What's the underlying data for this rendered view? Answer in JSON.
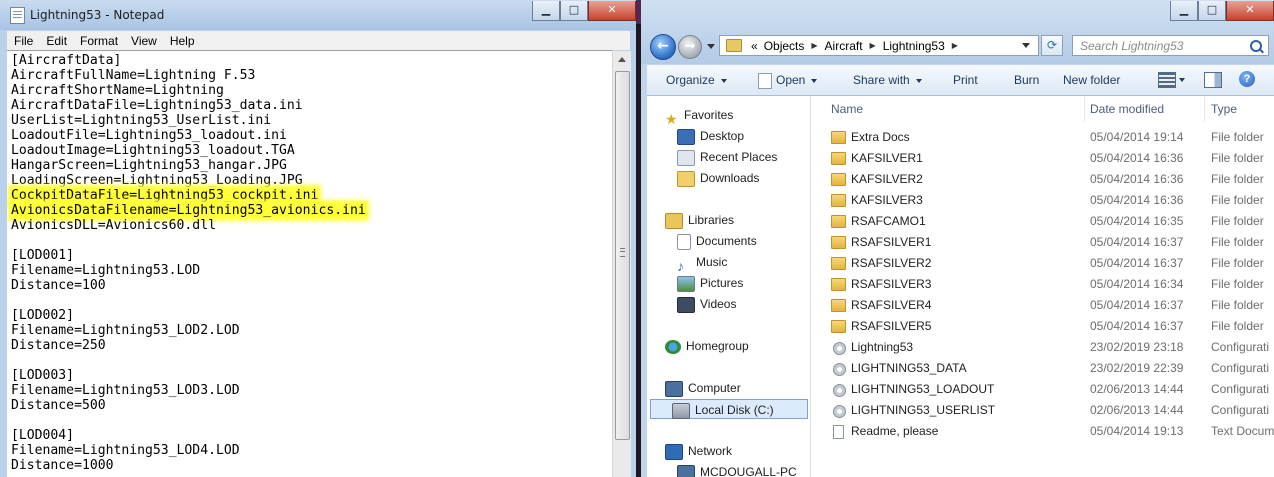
{
  "notepad": {
    "title": "Lightning53 - Notepad",
    "menu": [
      "File",
      "Edit",
      "Format",
      "View",
      "Help"
    ],
    "lines": [
      "[AircraftData]",
      "AircraftFullName=Lightning F.53",
      "AircraftShortName=Lightning",
      "AircraftDataFile=Lightning53_data.ini",
      "UserList=Lightning53_UserList.ini",
      "LoadoutFile=Lightning53_loadout.ini",
      "LoadoutImage=Lightning53_loadout.TGA",
      "HangarScreen=Lightning53_hangar.JPG",
      "LoadingScreen=Lightning53_Loading.JPG",
      "CockpitDataFile=Lightning53_cockpit.ini",
      "AvionicsDataFilename=Lightning53_avionics.ini",
      "AvionicsDLL=Avionics60.dll",
      "",
      "[LOD001]",
      "Filename=Lightning53.LOD",
      "Distance=100",
      "",
      "[LOD002]",
      "Filename=Lightning53_LOD2.LOD",
      "Distance=250",
      "",
      "[LOD003]",
      "Filename=Lightning53_LOD3.LOD",
      "Distance=500",
      "",
      "[LOD004]",
      "Filename=Lightning53_LOD4.LOD",
      "Distance=1000"
    ],
    "highlighted_lines": [
      9,
      10
    ],
    "highlight_color": "#ffff3a"
  },
  "explorer": {
    "address": {
      "overflow": "«",
      "segments": [
        "Objects",
        "Aircraft",
        "Lightning53"
      ]
    },
    "search_placeholder": "Search Lightning53",
    "toolbar": {
      "organize": "Organize",
      "open": "Open",
      "share_with": "Share with",
      "print": "Print",
      "burn": "Burn",
      "new_folder": "New folder"
    },
    "nav": {
      "favorites": "Favorites",
      "desktop": "Desktop",
      "recent_places": "Recent Places",
      "downloads": "Downloads",
      "libraries": "Libraries",
      "documents": "Documents",
      "music": "Music",
      "pictures": "Pictures",
      "videos": "Videos",
      "homegroup": "Homegroup",
      "computer": "Computer",
      "local_disk": "Local Disk (C:)",
      "network": "Network",
      "network_pc": "MCDOUGALL-PC"
    },
    "columns": {
      "name": "Name",
      "date_modified": "Date modified",
      "type": "Type"
    },
    "files": [
      {
        "name": "Extra Docs",
        "date": "05/04/2014 19:14",
        "type": "File folder",
        "icon": "folder-icon"
      },
      {
        "name": "KAFSILVER1",
        "date": "05/04/2014 16:36",
        "type": "File folder",
        "icon": "folder-icon"
      },
      {
        "name": "KAFSILVER2",
        "date": "05/04/2014 16:36",
        "type": "File folder",
        "icon": "folder-icon"
      },
      {
        "name": "KAFSILVER3",
        "date": "05/04/2014 16:36",
        "type": "File folder",
        "icon": "folder-icon"
      },
      {
        "name": "RSAFCAMO1",
        "date": "05/04/2014 16:35",
        "type": "File folder",
        "icon": "folder-icon"
      },
      {
        "name": "RSAFSILVER1",
        "date": "05/04/2014 16:37",
        "type": "File folder",
        "icon": "folder-icon"
      },
      {
        "name": "RSAFSILVER2",
        "date": "05/04/2014 16:37",
        "type": "File folder",
        "icon": "folder-icon"
      },
      {
        "name": "RSAFSILVER3",
        "date": "05/04/2014 16:34",
        "type": "File folder",
        "icon": "folder-icon"
      },
      {
        "name": "RSAFSILVER4",
        "date": "05/04/2014 16:37",
        "type": "File folder",
        "icon": "folder-icon"
      },
      {
        "name": "RSAFSILVER5",
        "date": "05/04/2014 16:37",
        "type": "File folder",
        "icon": "folder-icon"
      },
      {
        "name": "Lightning53",
        "date": "23/02/2019 23:18",
        "type": "Configurati",
        "icon": "config-file-icon"
      },
      {
        "name": "LIGHTNING53_DATA",
        "date": "23/02/2019 22:39",
        "type": "Configurati",
        "icon": "config-file-icon"
      },
      {
        "name": "LIGHTNING53_LOADOUT",
        "date": "02/06/2013 14:44",
        "type": "Configurati",
        "icon": "config-file-icon"
      },
      {
        "name": "LIGHTNING53_USERLIST",
        "date": "02/06/2013 14:44",
        "type": "Configurati",
        "icon": "config-file-icon"
      },
      {
        "name": "Readme, please",
        "date": "05/04/2014 19:13",
        "type": "Text Docum",
        "icon": "text-file-icon"
      }
    ]
  }
}
